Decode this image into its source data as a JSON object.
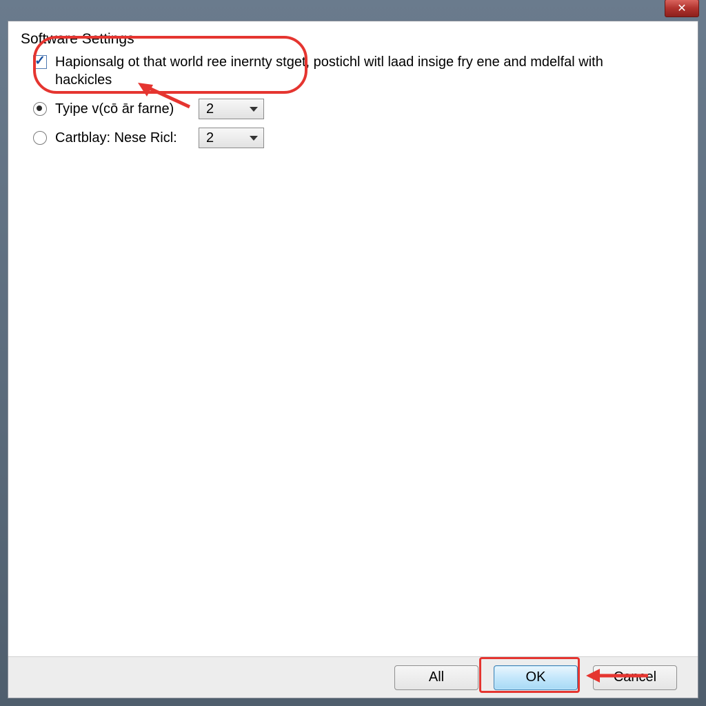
{
  "window": {
    "title": ""
  },
  "settings": {
    "section_title": "Software Settings",
    "checkbox": {
      "label": "Hapionsalg ot that world ree inernty stget, postichl witl laad insige fry ene and mdelfal with hackicles",
      "checked": true
    },
    "radio_group": [
      {
        "label": "Tyipe v(cō ār farne)",
        "selected": true,
        "value": "2"
      },
      {
        "label": "Cartblay: Nese Ricl:",
        "selected": false,
        "value": "2"
      }
    ]
  },
  "buttons": {
    "all": "All",
    "ok": "OK",
    "cancel": "Cancel"
  },
  "annotation_color": "#e53530"
}
